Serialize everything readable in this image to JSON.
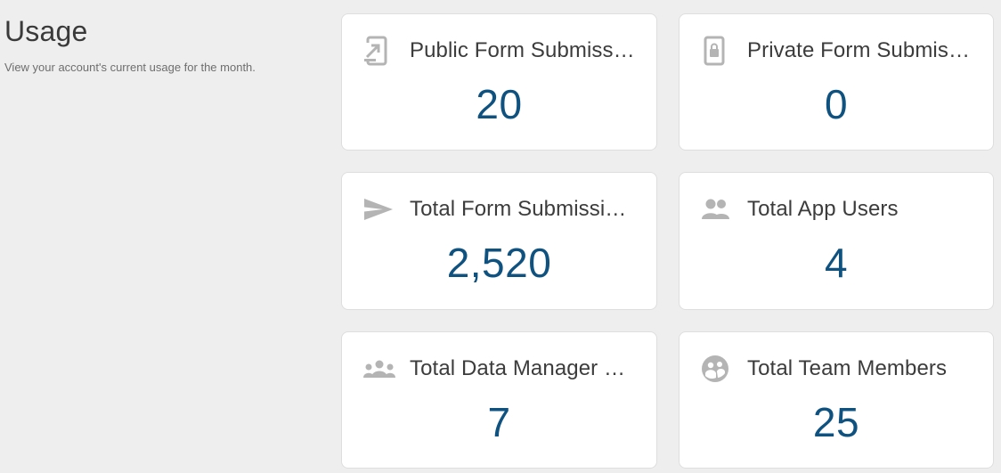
{
  "header": {
    "title": "Usage",
    "subtitle": "View your account's current usage for the month."
  },
  "cards": [
    {
      "label": "Public Form Submissions",
      "value": "20",
      "icon": "tablet-arrow-icon"
    },
    {
      "label": "Private Form Submissions",
      "value": "0",
      "icon": "tablet-lock-icon"
    },
    {
      "label": "Total Form Submissions",
      "value": "2,520",
      "icon": "send-icon"
    },
    {
      "label": "Total App Users",
      "value": "4",
      "icon": "people-icon"
    },
    {
      "label": "Total Data Manager Users",
      "value": "7",
      "icon": "group-icon"
    },
    {
      "label": "Total Team Members",
      "value": "25",
      "icon": "team-circle-icon"
    }
  ],
  "colors": {
    "background": "#eeeeee",
    "card": "#ffffff",
    "value": "#0f5280",
    "icon": "#b4b4b4"
  }
}
